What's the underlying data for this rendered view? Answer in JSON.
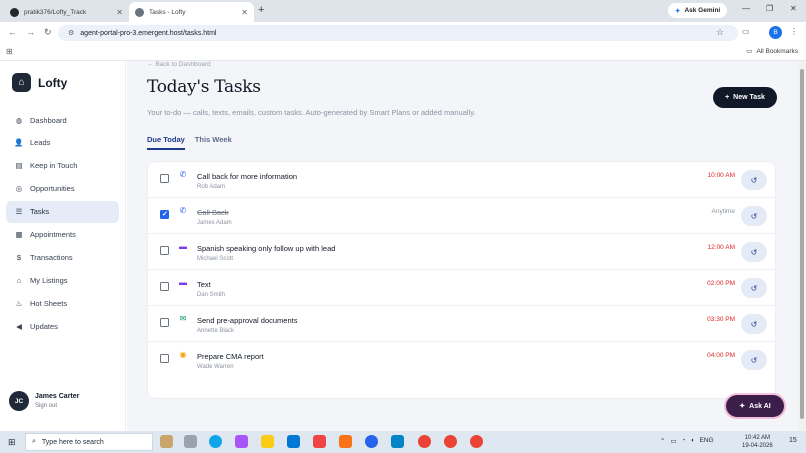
{
  "browser": {
    "tabs": [
      {
        "title": "pratik376/Lofty_Track",
        "active": false
      },
      {
        "title": "Tasks - Lofty",
        "active": true
      }
    ],
    "gemini_label": "Ask Gemini",
    "url": "agent-portal-pro-3.emergent.host/tasks.html",
    "profile_initial": "B",
    "all_bookmarks": "All Bookmarks"
  },
  "sidebar": {
    "brand": "Lofty",
    "items": [
      {
        "label": "Dashboard",
        "icon": "dashboard-icon",
        "active": false
      },
      {
        "label": "Leads",
        "icon": "users-icon",
        "active": false
      },
      {
        "label": "Keep in Touch",
        "icon": "keep-in-touch-icon",
        "active": false
      },
      {
        "label": "Opportunities",
        "icon": "target-icon",
        "active": false
      },
      {
        "label": "Tasks",
        "icon": "list-icon",
        "active": true
      },
      {
        "label": "Appointments",
        "icon": "calendar-icon",
        "active": false
      },
      {
        "label": "Transactions",
        "icon": "dollar-icon",
        "active": false
      },
      {
        "label": "My Listings",
        "icon": "house-icon",
        "active": false
      },
      {
        "label": "Hot Sheets",
        "icon": "flame-icon",
        "active": false
      },
      {
        "label": "Updates",
        "icon": "megaphone-icon",
        "active": false
      }
    ],
    "user": {
      "initials": "JC",
      "name": "James Carter",
      "signout": "Sign out"
    }
  },
  "main": {
    "back_link": "Back to Dashboard",
    "title": "Today's Tasks",
    "subtitle": "Your to-do — calls, texts, emails, custom tasks. Auto-generated by Smart Plans or added manually.",
    "new_task_label": "New Task",
    "tabs": [
      {
        "label": "Due Today",
        "active": true
      },
      {
        "label": "This Week",
        "active": false
      }
    ],
    "tasks": [
      {
        "title": "Call back for more information",
        "person": "Rob Adam",
        "time": "10:00 AM",
        "type": "phone-icon",
        "done": false,
        "overdue": true
      },
      {
        "title": "Call Back",
        "person": "James Adam",
        "time": "Anytime",
        "type": "phone-icon",
        "done": true,
        "overdue": false
      },
      {
        "title": "Spanish speaking only follow up with lead",
        "person": "Michael Scott",
        "time": "12:00 AM",
        "type": "chat-icon",
        "done": false,
        "overdue": true
      },
      {
        "title": "Text",
        "person": "Dan Smith",
        "time": "02:00 PM",
        "type": "chat-icon",
        "done": false,
        "overdue": true
      },
      {
        "title": "Send pre-approval documents",
        "person": "Annette Black",
        "time": "03:30 PM",
        "type": "email-icon",
        "done": false,
        "overdue": true
      },
      {
        "title": "Prepare CMA report",
        "person": "Wade Warren",
        "time": "04:00 PM",
        "type": "custom-task-icon",
        "done": false,
        "overdue": true
      }
    ],
    "ask_ai_label": "Ask AI"
  },
  "taskbar": {
    "search_placeholder": "Type here to search",
    "language": "ENG",
    "time": "10:42 AM",
    "date": "19-04-2026",
    "notification_count": "15"
  },
  "colors": {
    "accent_navy": "#1e3a8a",
    "overdue_red": "#dc2626",
    "checkbox_blue": "#2563eb",
    "phone_blue": "#2563eb",
    "chat_purple": "#7c3aed",
    "email_green": "#059669",
    "task_amber": "#f59e0b"
  }
}
